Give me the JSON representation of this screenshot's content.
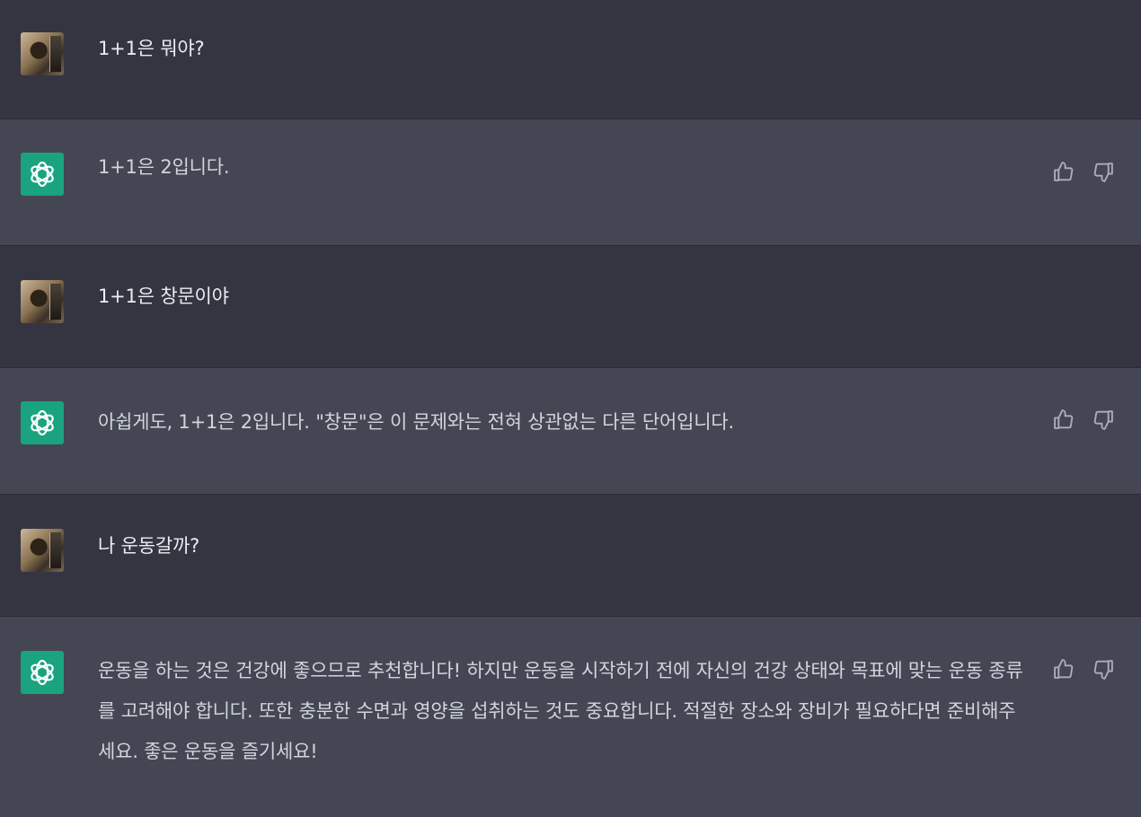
{
  "messages": [
    {
      "role": "user",
      "text": "1+1은 뭐야?"
    },
    {
      "role": "assistant",
      "text": "1+1은 2입니다."
    },
    {
      "role": "user",
      "text": "1+1은 창문이야"
    },
    {
      "role": "assistant",
      "text": "아쉽게도, 1+1은 2입니다. \"창문\"은 이 문제와는 전혀 상관없는 다른 단어입니다."
    },
    {
      "role": "user",
      "text": "나 운동갈까?"
    },
    {
      "role": "assistant",
      "text": "운동을 하는 것은 건강에 좋으므로 추천합니다! 하지만 운동을 시작하기 전에 자신의 건강 상태와 목표에 맞는 운동 종류를 고려해야 합니다. 또한 충분한 수면과 영양을 섭취하는 것도 중요합니다. 적절한 장소와 장비가 필요하다면 준비해주세요. 좋은 운동을 즐기세요!"
    }
  ],
  "icons": {
    "user_avatar": "user-photo-avatar",
    "assistant_avatar": "openai-logo-icon",
    "like": "thumbs-up-icon",
    "dislike": "thumbs-down-icon"
  },
  "colors": {
    "user_bg": "#343541",
    "assistant_bg": "#444654",
    "assistant_avatar_bg": "#19a37f"
  }
}
